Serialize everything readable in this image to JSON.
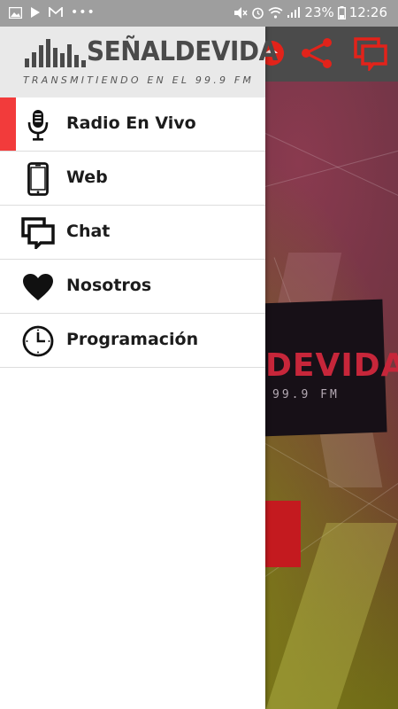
{
  "status_bar": {
    "left_icons": [
      "image-notification-icon",
      "play-notification-icon",
      "gmail-notification-icon",
      "more-notifications-icon"
    ],
    "right_icons": [
      "mute-icon",
      "alarm-icon",
      "wifi-icon",
      "signal-icon",
      "battery-icon"
    ],
    "battery": "23%",
    "time": "12:26"
  },
  "drawer": {
    "brand": {
      "name": "SEÑALDEVIDA",
      "tagline": "TRANSMITIENDO EN EL 99.9 FM"
    },
    "menu": [
      {
        "label": "Radio En Vivo",
        "icon": "microphone-icon",
        "active": true
      },
      {
        "label": "Web",
        "icon": "phone-icon",
        "active": false
      },
      {
        "label": "Chat",
        "icon": "chat-icon",
        "active": false
      },
      {
        "label": "Nosotros",
        "icon": "heart-icon",
        "active": false
      },
      {
        "label": "Programación",
        "icon": "clock-icon",
        "active": false
      }
    ]
  },
  "background_app": {
    "toolbar_icons": [
      "record-icon",
      "share-icon",
      "chat-icon"
    ],
    "logo_text": "DEVIDA",
    "logo_sub": "99.9 FM"
  },
  "colors": {
    "accent": "#f23b3b",
    "status_bar": "#9e9e9e",
    "drawer_header": "#e9e9e9",
    "toolbar_icon": "#e2231a"
  }
}
